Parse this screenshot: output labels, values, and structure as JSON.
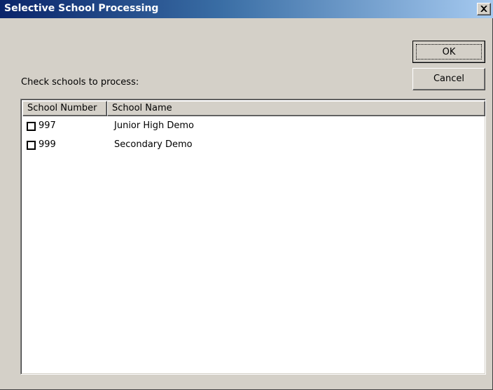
{
  "window": {
    "title": "Selective School Processing",
    "close_symbol": "×"
  },
  "buttons": {
    "ok_label": "OK",
    "cancel_label": "Cancel"
  },
  "instructions": "Check schools to process:",
  "list": {
    "columns": [
      "School Number",
      "School Name"
    ],
    "rows": [
      {
        "number": "997",
        "name": "Junior High Demo",
        "checked": false
      },
      {
        "number": "999",
        "name": "Secondary Demo",
        "checked": false
      }
    ]
  },
  "colors": {
    "titlebar_start": "#0a246a",
    "titlebar_end": "#a6caf0",
    "dialog_bg": "#d4d0c8"
  }
}
